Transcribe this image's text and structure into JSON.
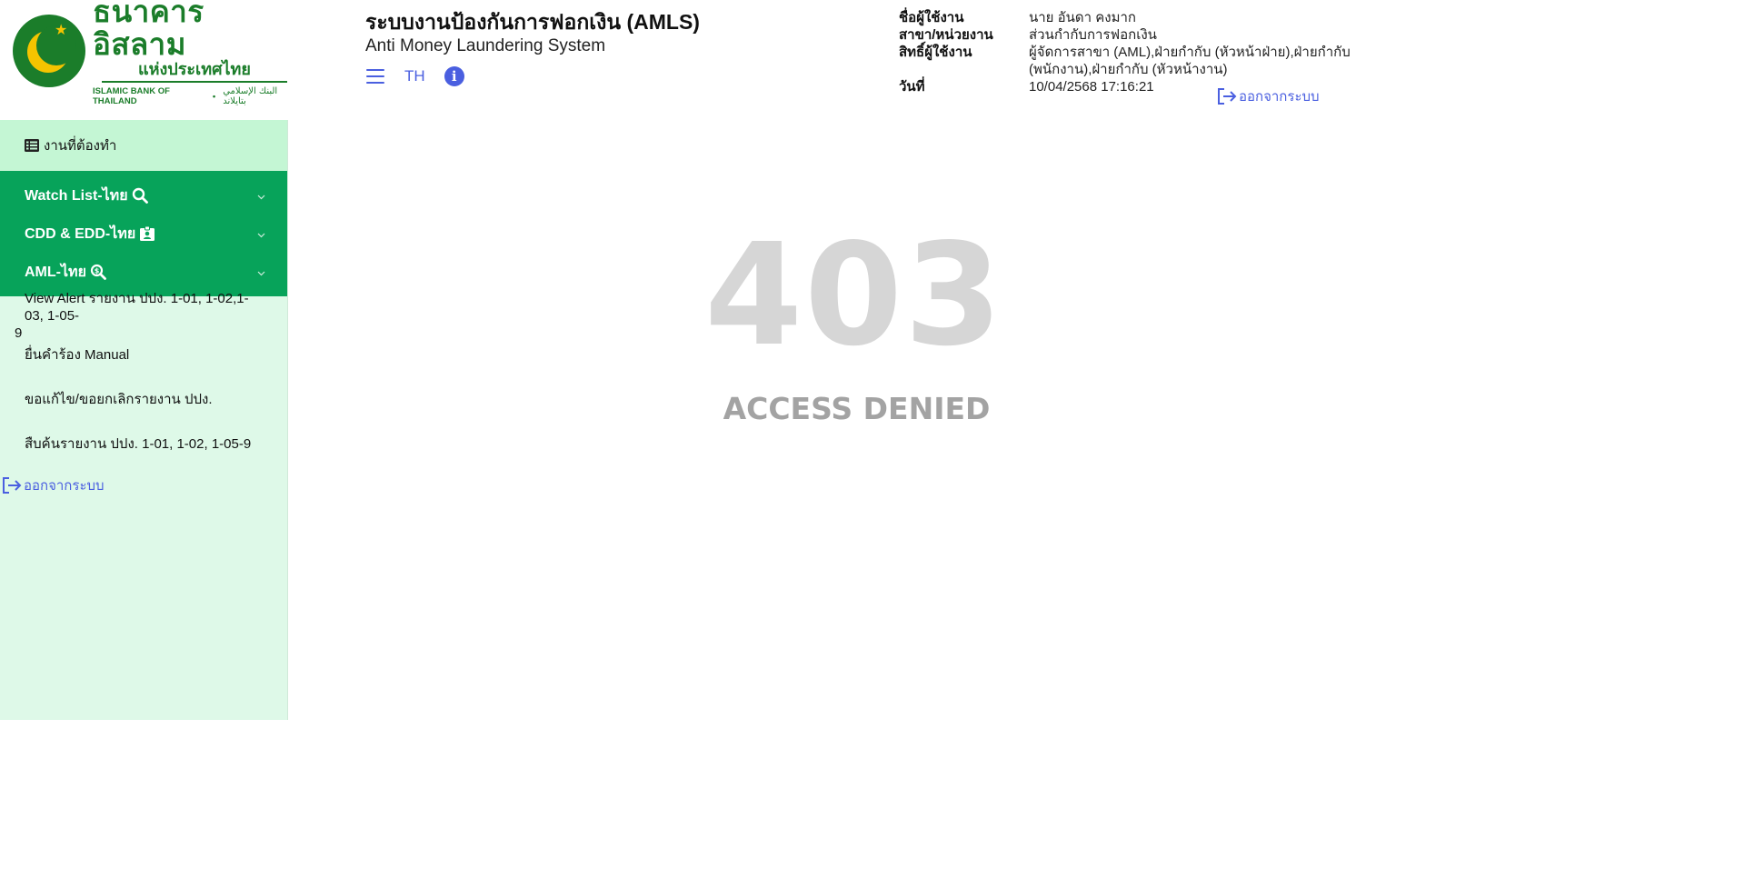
{
  "logo": {
    "thai_line1": "ธนาคารอิสลาม",
    "thai_line2": "แห่งประเทศไทย",
    "english": "ISLAMIC BANK OF THAILAND",
    "arabic": "البنك الإسلامي بتايلاند",
    "brand_color": "#1b7d2a",
    "accent_color": "#f5c400"
  },
  "header": {
    "title": "ระบบงานป้องกันการฟอกเงิน (AMLS)",
    "subtitle": "Anti Money Laundering System",
    "menu_icon": "hamburger-icon",
    "language": "TH",
    "info_icon": "info-icon",
    "info_glyph": "i"
  },
  "user": {
    "name_label": "ชื่อผู้ใช้งาน",
    "name_value": "นาย อันดา คงมาก",
    "branch_label": "สาขา/หน่วยงาน",
    "branch_value": "ส่วนกำกับการฟอกเงิน",
    "rights_label": "สิทธิ์ผู้ใช้งาน",
    "rights_value": "ผู้จัดการสาขา (AML),ฝ่ายกำกับ (หัวหน้าฝ่าย),ฝ่ายกำกับ (พนักงาน),ฝ่ายกำกับ (หัวหน้างาน)",
    "date_label": "วันที่",
    "date_value": "10/04/2568 17:16:21",
    "logout_label": "ออกจากระบบ"
  },
  "sidebar": {
    "todo_label": "งานที่ต้องทำ",
    "menus": [
      {
        "label": "Watch List-ไทย",
        "icon": "search-icon"
      },
      {
        "label": "CDD & EDD-ไทย",
        "icon": "id-badge-icon"
      },
      {
        "label": "AML-ไทย",
        "icon": "search-dollar-icon"
      }
    ],
    "sub_items": [
      {
        "line1": "View Alert รายงาน ปปง. 1-01, 1-02,1-03, 1-05-",
        "line2": "9"
      },
      {
        "label": "ยื่นคำร้อง Manual"
      },
      {
        "label": "ขอแก้ไข/ขอยกเลิกรายงาน ปปง."
      },
      {
        "label": "สืบค้นรายงาน ปปง. 1-01, 1-02, 1-05-9"
      }
    ],
    "logout_label": "ออกจากระบบ",
    "menu_color": "#07a35a",
    "background_color": "#def9e8"
  },
  "main": {
    "error_code": "403",
    "error_message": "ACCESS DENIED"
  },
  "colors": {
    "link": "#4a5fe0",
    "error_code": "#d6d6d6",
    "error_text": "#a3a3a3"
  }
}
